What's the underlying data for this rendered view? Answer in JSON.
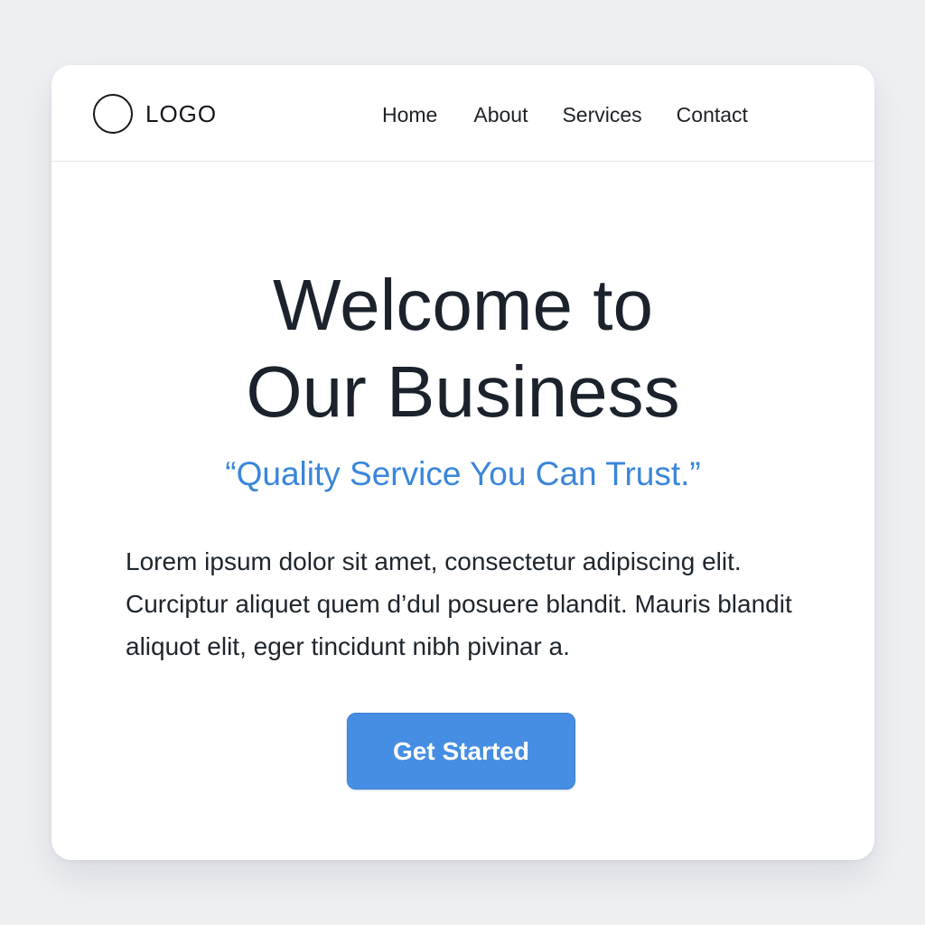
{
  "header": {
    "logo_text": "LOGO",
    "nav": [
      {
        "label": "Home"
      },
      {
        "label": "About"
      },
      {
        "label": "Services"
      },
      {
        "label": "Contact"
      }
    ]
  },
  "hero": {
    "title_line1": "Welcome to",
    "title_line2": "Our Business",
    "tagline": "“Quality Service You Can Trust.”",
    "body": "Lorem ipsum dolor sit amet, consectetur adipiscing elit. Curciptur aliquet quem d’dul posuere blandit. Mauris blandit aliquot elit, eger tincidunt nibh pivinar a.",
    "cta_label": "Get Started"
  },
  "colors": {
    "accent": "#458ee3",
    "tagline": "#3a86db",
    "text": "#1b222b",
    "background": "#eef0f3",
    "card": "#ffffff"
  }
}
